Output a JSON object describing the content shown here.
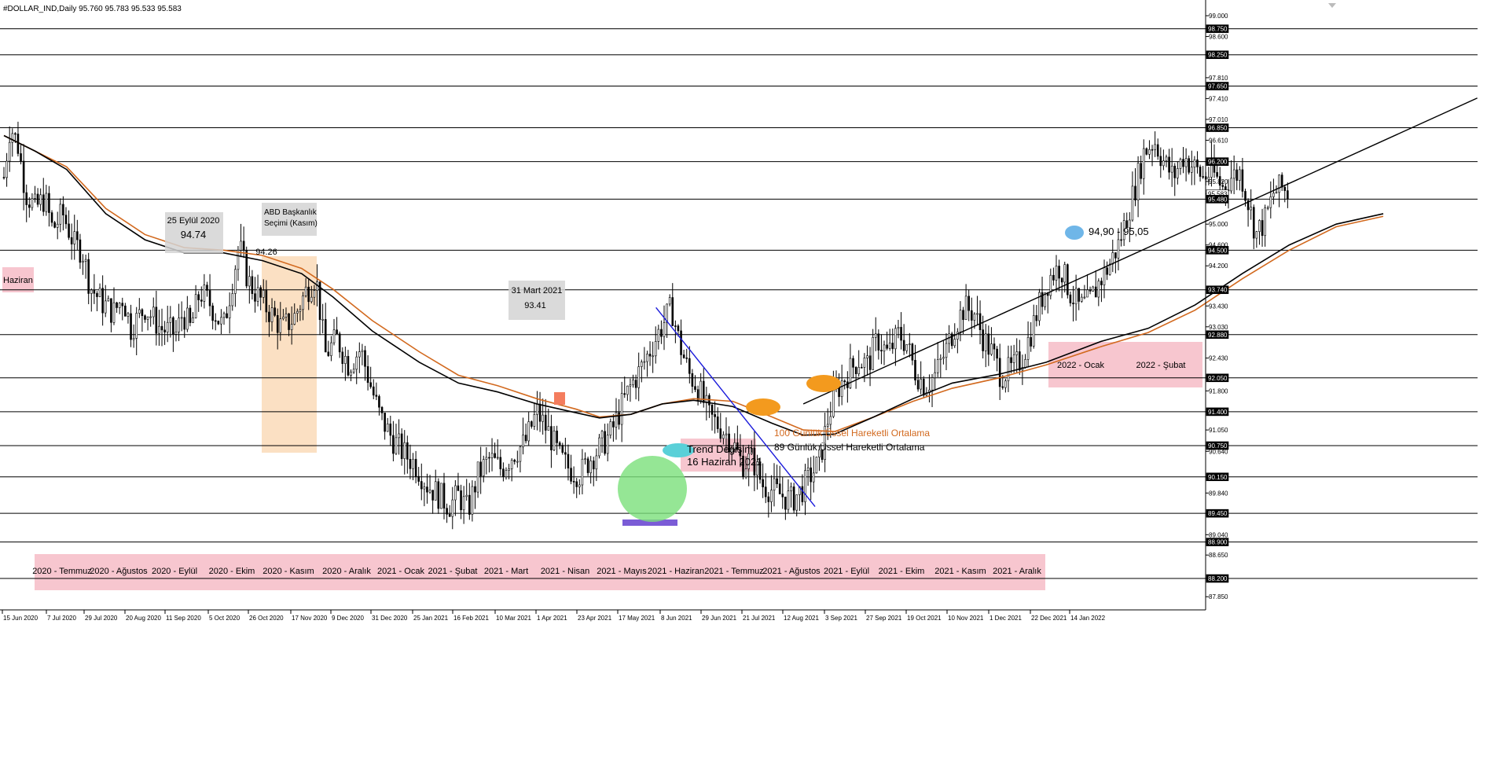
{
  "window": {
    "title": "#DOLLAR_IND,Daily  95.760 95.783 95.533 95.583"
  },
  "chart_data": {
    "type": "candlestick",
    "symbol": "#DOLLAR_IND",
    "timeframe": "Daily",
    "ohlc_last": [
      95.76,
      95.783,
      95.533,
      95.583
    ],
    "ylim": [
      87.55,
      99.2
    ],
    "y_ticks": [
      "99.000",
      "98.600",
      "98.250",
      "97.810",
      "97.410",
      "97.010",
      "96.610",
      "96.200",
      "95.820",
      "95.583",
      "95.480",
      "95.000",
      "94.600",
      "94.500",
      "94.200",
      "93.740",
      "93.430",
      "93.030",
      "92.880",
      "92.430",
      "92.050",
      "91.800",
      "91.400",
      "91.050",
      "90.750",
      "90.640",
      "90.150",
      "89.840",
      "89.450",
      "89.040",
      "88.900",
      "88.650",
      "88.200",
      "87.850"
    ],
    "y_tick_values": [
      99.0,
      98.6,
      98.25,
      97.81,
      97.41,
      97.01,
      96.61,
      96.2,
      95.82,
      95.583,
      95.48,
      95.0,
      94.6,
      94.5,
      94.2,
      93.74,
      93.43,
      93.03,
      92.88,
      92.43,
      92.05,
      91.8,
      91.4,
      91.05,
      90.75,
      90.64,
      90.15,
      89.84,
      89.45,
      89.04,
      88.9,
      88.65,
      88.2,
      87.85
    ],
    "highlight_levels": [
      "98.750",
      "98.250",
      "97.650",
      "96.850",
      "96.200",
      "95.583",
      "95.480",
      "94.500",
      "93.740",
      "92.880",
      "92.050",
      "91.400",
      "90.750",
      "90.150",
      "89.450",
      "88.900",
      "88.200"
    ],
    "levels": [
      98.75,
      98.25,
      97.65,
      96.85,
      96.2,
      95.48,
      94.5,
      93.74,
      92.88,
      92.05,
      91.4,
      90.75,
      90.15,
      89.45,
      88.9,
      88.2
    ],
    "current_price": 95.583,
    "x_labels": [
      "15 Jun 2020",
      "7 Jul 2020",
      "29 Jul 2020",
      "20 Aug 2020",
      "11 Sep 2020",
      "5 Oct 2020",
      "26 Oct 2020",
      "17 Nov 2020",
      "9 Dec 2020",
      "31 Dec 2020",
      "25 Jan 2021",
      "16 Feb 2021",
      "10 Mar 2021",
      "1 Apr 2021",
      "23 Apr 2021",
      "17 May 2021",
      "8 Jun 2021",
      "29 Jun 2021",
      "21 Jul 2021",
      "12 Aug 2021",
      "3 Sep 2021",
      "27 Sep 2021",
      "19 Oct 2021",
      "10 Nov 2021",
      "1 Dec 2021",
      "22 Dec 2021",
      "14 Jan 2022"
    ],
    "price_path": [
      [
        0,
        95.9
      ],
      [
        8,
        96.9
      ],
      [
        18,
        96.5
      ],
      [
        28,
        95.6
      ],
      [
        40,
        95.3
      ],
      [
        52,
        95.5
      ],
      [
        62,
        94.9
      ],
      [
        75,
        95.2
      ],
      [
        90,
        94.6
      ],
      [
        100,
        94.5
      ],
      [
        110,
        93.8
      ],
      [
        125,
        93.5
      ],
      [
        140,
        93.3
      ],
      [
        152,
        93.6
      ],
      [
        162,
        93.0
      ],
      [
        180,
        93.4
      ],
      [
        200,
        93.0
      ],
      [
        220,
        92.9
      ],
      [
        228,
        93.3
      ],
      [
        238,
        93.0
      ],
      [
        250,
        93.7
      ],
      [
        262,
        93.5
      ],
      [
        280,
        93.0
      ],
      [
        300,
        94.6
      ],
      [
        312,
        93.9
      ],
      [
        325,
        93.6
      ],
      [
        340,
        93.3
      ],
      [
        355,
        93.0
      ],
      [
        370,
        93.2
      ],
      [
        385,
        93.7
      ],
      [
        398,
        94.0
      ],
      [
        410,
        92.5
      ],
      [
        425,
        92.8
      ],
      [
        440,
        92.3
      ],
      [
        455,
        92.6
      ],
      [
        468,
        91.9
      ],
      [
        480,
        91.3
      ],
      [
        495,
        90.9
      ],
      [
        510,
        90.6
      ],
      [
        525,
        90.4
      ],
      [
        540,
        90.0
      ],
      [
        555,
        89.8
      ],
      [
        568,
        89.6
      ],
      [
        580,
        89.8
      ],
      [
        592,
        89.5
      ],
      [
        605,
        90.2
      ],
      [
        620,
        90.5
      ],
      [
        635,
        90.3
      ],
      [
        650,
        90.6
      ],
      [
        665,
        90.8
      ],
      [
        680,
        91.4
      ],
      [
        695,
        91.0
      ],
      [
        710,
        90.5
      ],
      [
        722,
        90.3
      ],
      [
        735,
        90.2
      ],
      [
        748,
        90.5
      ],
      [
        760,
        90.7
      ],
      [
        775,
        91.0
      ],
      [
        788,
        91.5
      ],
      [
        800,
        91.9
      ],
      [
        812,
        92.2
      ],
      [
        825,
        92.6
      ],
      [
        838,
        93.0
      ],
      [
        852,
        93.4
      ],
      [
        862,
        92.7
      ],
      [
        875,
        92.1
      ],
      [
        885,
        91.9
      ],
      [
        900,
        91.3
      ],
      [
        915,
        91.1
      ],
      [
        930,
        90.8
      ],
      [
        942,
        90.4
      ],
      [
        955,
        90.5
      ],
      [
        968,
        90.0
      ],
      [
        980,
        89.9
      ],
      [
        992,
        89.8
      ],
      [
        1005,
        89.7
      ],
      [
        1018,
        89.9
      ],
      [
        1030,
        90.2
      ],
      [
        1040,
        90.4
      ],
      [
        1052,
        91.3
      ],
      [
        1062,
        91.8
      ],
      [
        1075,
        92.1
      ],
      [
        1090,
        92.4
      ],
      [
        1102,
        92.3
      ],
      [
        1115,
        92.8
      ],
      [
        1128,
        92.5
      ],
      [
        1142,
        92.9
      ],
      [
        1152,
        92.7
      ],
      [
        1162,
        92.2
      ],
      [
        1175,
        91.9
      ],
      [
        1188,
        92.1
      ],
      [
        1200,
        92.5
      ],
      [
        1212,
        93.0
      ],
      [
        1225,
        93.4
      ],
      [
        1238,
        93.3
      ],
      [
        1250,
        92.8
      ],
      [
        1262,
        92.5
      ],
      [
        1272,
        92.1
      ],
      [
        1285,
        92.2
      ],
      [
        1298,
        92.4
      ],
      [
        1310,
        92.9
      ],
      [
        1322,
        93.5
      ],
      [
        1335,
        94.0
      ],
      [
        1348,
        94.2
      ],
      [
        1360,
        93.7
      ],
      [
        1372,
        93.4
      ],
      [
        1385,
        93.5
      ],
      [
        1398,
        93.9
      ],
      [
        1410,
        94.2
      ],
      [
        1422,
        94.6
      ],
      [
        1432,
        95.1
      ],
      [
        1445,
        95.8
      ],
      [
        1455,
        96.4
      ],
      [
        1468,
        96.6
      ],
      [
        1480,
        96.2
      ],
      [
        1492,
        95.9
      ],
      [
        1505,
        96.3
      ],
      [
        1518,
        96.1
      ],
      [
        1530,
        95.9
      ],
      [
        1542,
        96.0
      ],
      [
        1555,
        95.7
      ],
      [
        1565,
        95.9
      ],
      [
        1578,
        96.0
      ],
      [
        1588,
        95.4
      ],
      [
        1598,
        94.8
      ],
      [
        1610,
        95.1
      ],
      [
        1620,
        95.6
      ],
      [
        1630,
        95.7
      ],
      [
        1640,
        95.583
      ]
    ],
    "series": [
      {
        "name": "100 Günlük Üssel Hareketli Ortalama",
        "color": "#d2691e",
        "points": [
          [
            0,
            96.7
          ],
          [
            40,
            96.4
          ],
          [
            80,
            96.1
          ],
          [
            130,
            95.3
          ],
          [
            180,
            94.8
          ],
          [
            230,
            94.55
          ],
          [
            280,
            94.5
          ],
          [
            330,
            94.4
          ],
          [
            380,
            94.15
          ],
          [
            420,
            93.75
          ],
          [
            470,
            93.15
          ],
          [
            530,
            92.55
          ],
          [
            580,
            92.1
          ],
          [
            630,
            91.9
          ],
          [
            680,
            91.65
          ],
          [
            730,
            91.45
          ],
          [
            760,
            91.3
          ],
          [
            800,
            91.35
          ],
          [
            840,
            91.55
          ],
          [
            880,
            91.65
          ],
          [
            930,
            91.6
          ],
          [
            980,
            91.3
          ],
          [
            1020,
            91.05
          ],
          [
            1060,
            91.02
          ],
          [
            1110,
            91.3
          ],
          [
            1160,
            91.6
          ],
          [
            1210,
            91.85
          ],
          [
            1270,
            92.05
          ],
          [
            1330,
            92.3
          ],
          [
            1400,
            92.65
          ],
          [
            1460,
            92.92
          ],
          [
            1520,
            93.35
          ],
          [
            1580,
            93.95
          ],
          [
            1640,
            94.5
          ],
          [
            1700,
            94.95
          ],
          [
            1760,
            95.15
          ]
        ]
      },
      {
        "name": "89 Günlük Üssel Hareketli Ortalama",
        "color": "#000000",
        "points": [
          [
            0,
            96.7
          ],
          [
            40,
            96.4
          ],
          [
            80,
            96.05
          ],
          [
            130,
            95.2
          ],
          [
            180,
            94.7
          ],
          [
            230,
            94.45
          ],
          [
            280,
            94.45
          ],
          [
            330,
            94.3
          ],
          [
            380,
            94.05
          ],
          [
            420,
            93.6
          ],
          [
            470,
            92.95
          ],
          [
            530,
            92.35
          ],
          [
            580,
            91.95
          ],
          [
            630,
            91.78
          ],
          [
            680,
            91.55
          ],
          [
            730,
            91.38
          ],
          [
            760,
            91.28
          ],
          [
            800,
            91.35
          ],
          [
            840,
            91.55
          ],
          [
            880,
            91.62
          ],
          [
            930,
            91.5
          ],
          [
            980,
            91.18
          ],
          [
            1020,
            90.95
          ],
          [
            1060,
            90.97
          ],
          [
            1110,
            91.3
          ],
          [
            1160,
            91.65
          ],
          [
            1210,
            91.95
          ],
          [
            1270,
            92.12
          ],
          [
            1330,
            92.35
          ],
          [
            1400,
            92.75
          ],
          [
            1460,
            93.0
          ],
          [
            1520,
            93.45
          ],
          [
            1580,
            94.05
          ],
          [
            1640,
            94.6
          ],
          [
            1700,
            95.0
          ],
          [
            1760,
            95.2
          ]
        ]
      }
    ],
    "trendlines": [
      {
        "from": [
          1020,
          91.55
        ],
        "to": [
          1880,
          97.42
        ],
        "color": "#000000"
      },
      {
        "from": [
          832,
          93.4
        ],
        "to": [
          1035,
          89.58
        ],
        "color": "#1a1adb"
      }
    ],
    "annotations": [
      {
        "lines": [
          "25 Eylül 2020",
          "94.74"
        ]
      },
      {
        "lines": [
          "ABD Başkanlık",
          "Seçimi (Kasım)"
        ]
      },
      {
        "lines": [
          "94.26"
        ]
      },
      {
        "lines": [
          "31 Mart 2021",
          "93.41"
        ]
      },
      {
        "lines": [
          "Trend Değişimi",
          "16 Haziran 2021"
        ]
      },
      {
        "lines": [
          "100 Günlük Üssel Hareketli Ortalama"
        ]
      },
      {
        "lines": [
          "89 Günlük Üssel Hareketli Ortalama"
        ]
      },
      {
        "lines": [
          "94,90 - 95,05"
        ]
      }
    ],
    "month_labels": [
      "2020 - Temmuz",
      "2020 - Ağustos",
      "2020 - Eylül",
      "2020 - Ekim",
      "2020 - Kasım",
      "2020 - Aralık",
      "2021 - Ocak",
      "2021 - Şubat",
      "2021 - Mart",
      "2021 - Nisan",
      "2021 - Mayıs",
      "2021 - Haziran",
      "2021 - Temmuz",
      "2021 - Ağustos",
      "2021 - Eylül",
      "2021 - Ekim",
      "2021 - Kasım",
      "2021 - Aralık",
      "2022 - Ocak",
      "2022 - Şubat",
      "Haziran"
    ],
    "colors": {
      "candle": "#000000",
      "grid_line": "#000000",
      "pink_box": "#f7c6cf",
      "orange_zone": "#fbe0c3",
      "gray_box": "#d4d4d4",
      "ema100": "#d2691e",
      "ema89": "#000000",
      "highlight_tag": "#000000",
      "price_tag": "#ffffff"
    }
  }
}
